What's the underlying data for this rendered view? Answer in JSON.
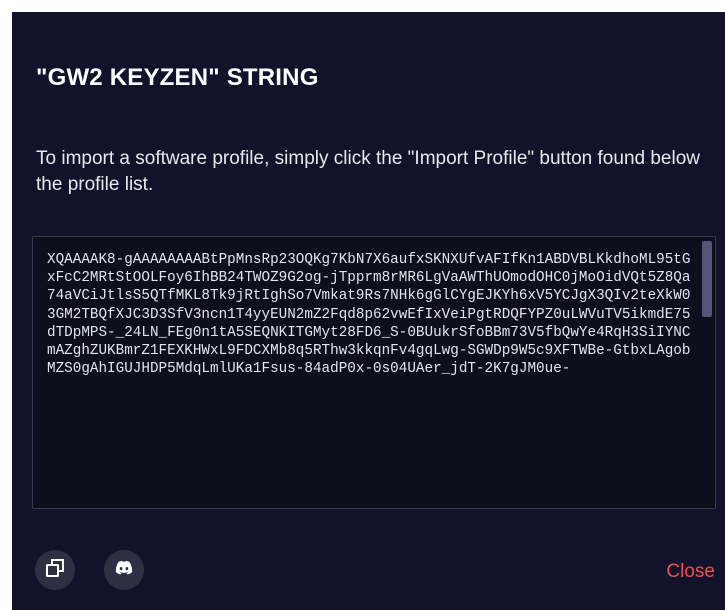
{
  "dialog": {
    "title": "\"GW2 KEYZEN\" STRING",
    "description": "To import a software profile, simply click the \"Import Profile\" button found below the profile list.",
    "key_string": "XQAAAAK8-gAAAAAAAABtPpMnsRp23OQKg7KbN7X6aufxSKNXUfvAFIfKn1ABDVBLKkdhoML95tGxFcC2MRtStOOLFoy6IhBB24TWOZ9G2og-jTpprm8rMR6LgVaAWThUOmodOHC0jMoOidVQt5Z8Qa74aVCiJtlsS5QTfMKL8Tk9jRtIghSo7Vmkat9Rs7NHk6gGlCYgEJKYh6xV5YCJgX3QIv2teXkW03GM2TBQfXJC3D3SfV3ncn1T4yyEUN2mZ2Fqd8p62vwEfIxVeiPgtRDQFYPZ0uLWVuTV5ikmdE75dTDpMPS-_24LN_FEg0n1tA5SEQNKITGMyt28FD6_S-0BUukrSfoBBm73V5fbQwYe4RqH3SiIYNCmAZghZUKBmrZ1FEXKHWxL9FDCXMb8q5RThw3kkqnFv4gqLwg-SGWDp9W5c9XFTWBe-GtbxLAgobMZS0gAhIGUJHDP5MdqLmlUKa1Fsus-84adP0x-0s04UAer_jdT-2K7gJM0ue-",
    "close_label": "Close"
  },
  "icons": {
    "copy": "copy-icon",
    "discord": "discord-icon"
  },
  "colors": {
    "background": "#12122a",
    "close": "#ef4f4f",
    "icon_button": "#2f2f44"
  }
}
